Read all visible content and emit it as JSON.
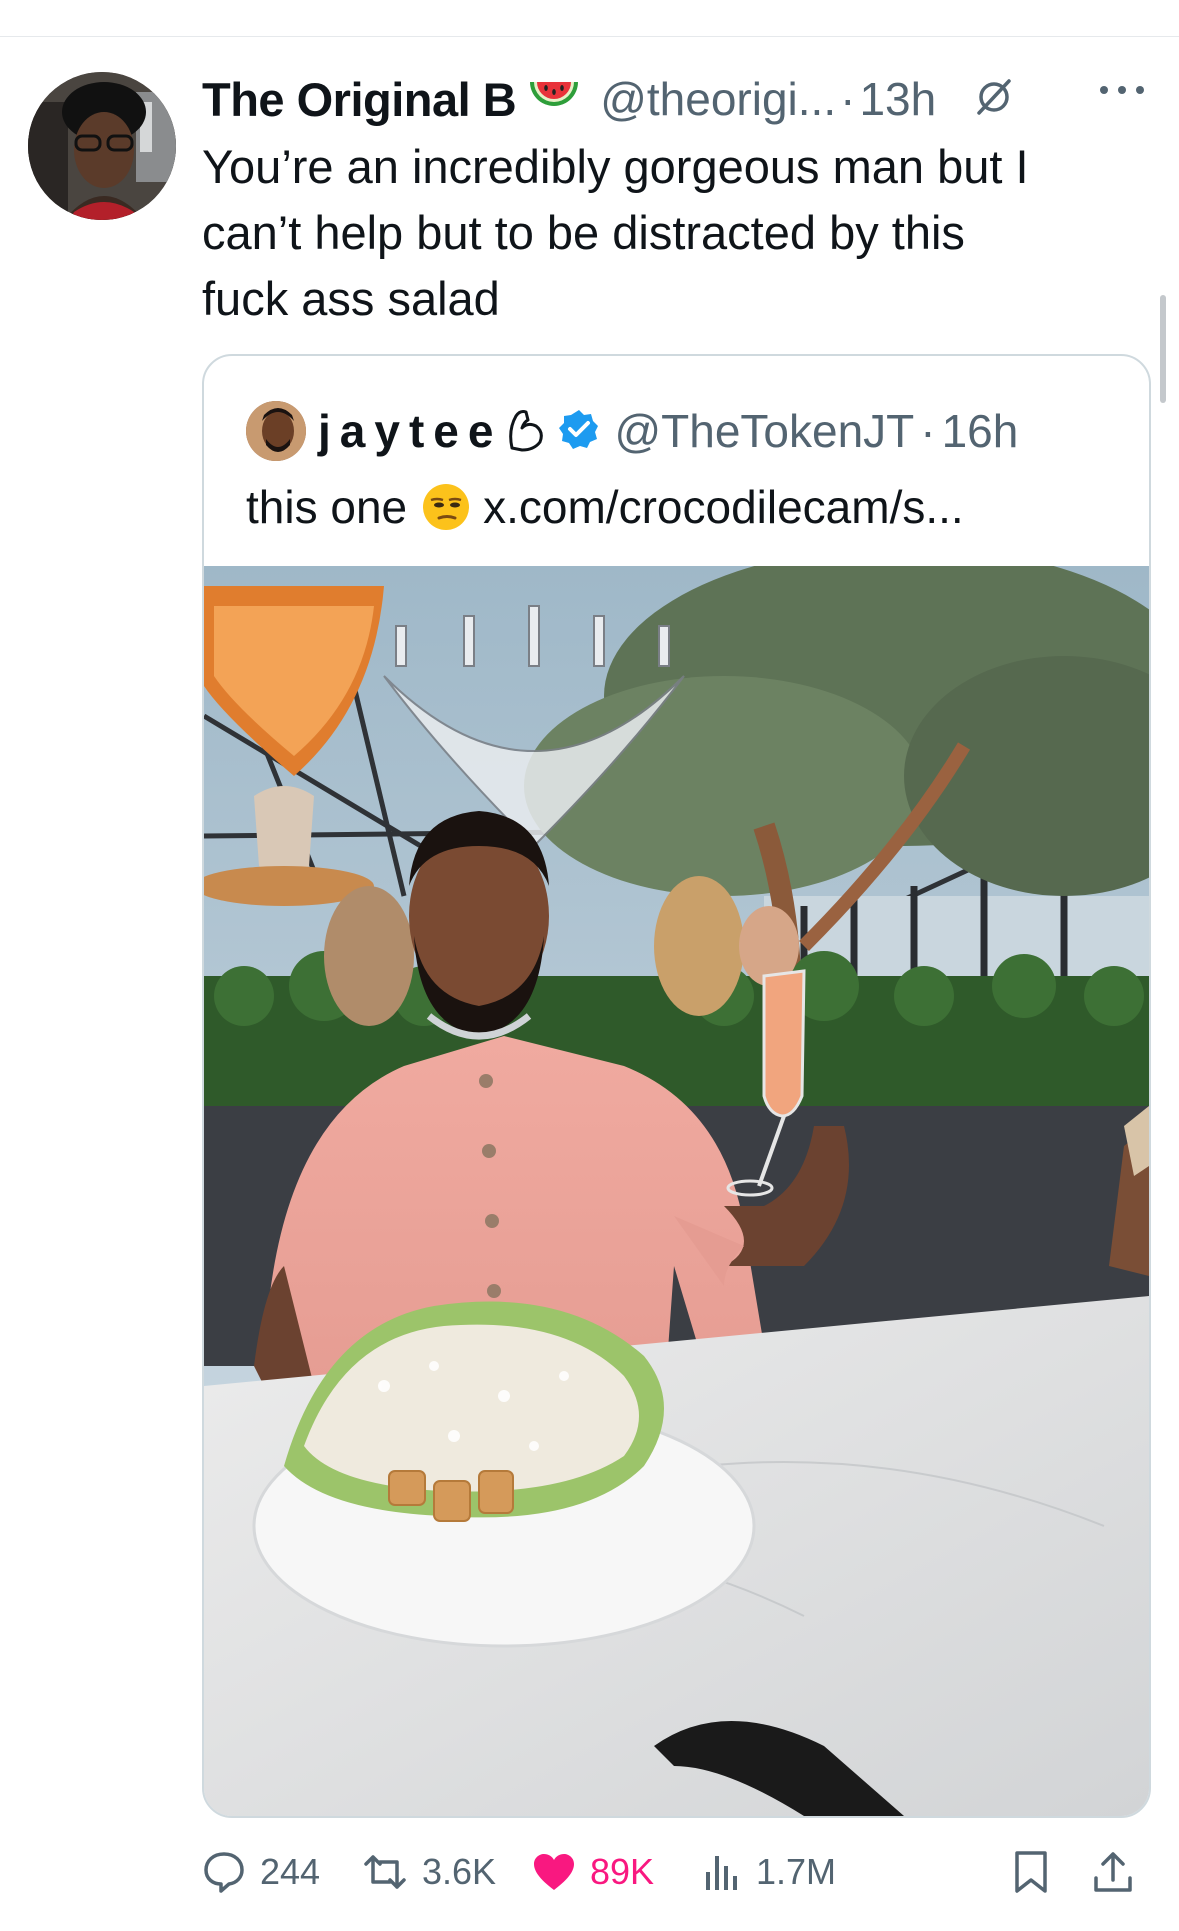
{
  "tweet": {
    "author_name": "The Original B",
    "author_emoji": "watermelon-emoji",
    "handle": "@theorigi...",
    "separator": "·",
    "time": "13h",
    "text": "You’re an incredibly gorgeous man but I\ncan’t help but to be distracted by this\nfuck ass salad"
  },
  "quote": {
    "author_name": "jaytee",
    "name_emoji": "flexed-bicep-emoji",
    "verified": true,
    "handle": "@TheTokenJT",
    "separator": "·",
    "time": "16h",
    "text": "this one",
    "text_emoji": "unamused-face-emoji",
    "link": "x.com/crocodilecam/s...",
    "image": "man in pink knit shirt holding a drink beside a large caesar salad in a restaurant"
  },
  "actions": {
    "replies": "244",
    "retweets": "3.6K",
    "likes": "89K",
    "views": "1.7M"
  },
  "colors": {
    "text": "#0f1419",
    "muted": "#536471",
    "like": "#f91880",
    "verified": "#1d9bf0",
    "border": "#cfd9de"
  }
}
